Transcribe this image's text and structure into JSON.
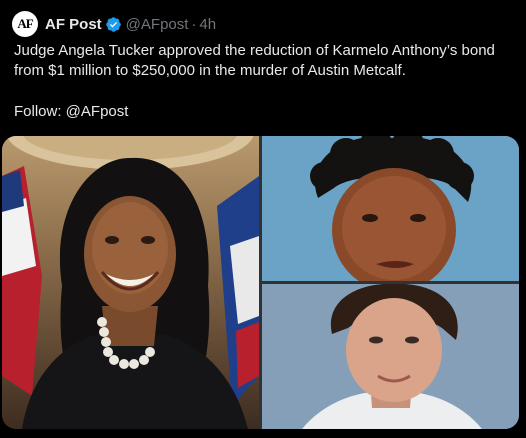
{
  "post": {
    "avatar_text": "AF",
    "display_name": "AF Post",
    "handle": "@AFpost",
    "separator": "·",
    "time": "4h",
    "text_line": "Judge Angela Tucker approved the reduction of Karmelo Anthony’s bond from $1 million to $250,000 in the murder of Austin Metcalf.",
    "follow_text": "Follow: @AFpost"
  },
  "colors": {
    "background": "#000000",
    "text_primary": "#e7e9ea",
    "text_secondary": "#71767b",
    "verified_blue": "#1d9bf0"
  }
}
